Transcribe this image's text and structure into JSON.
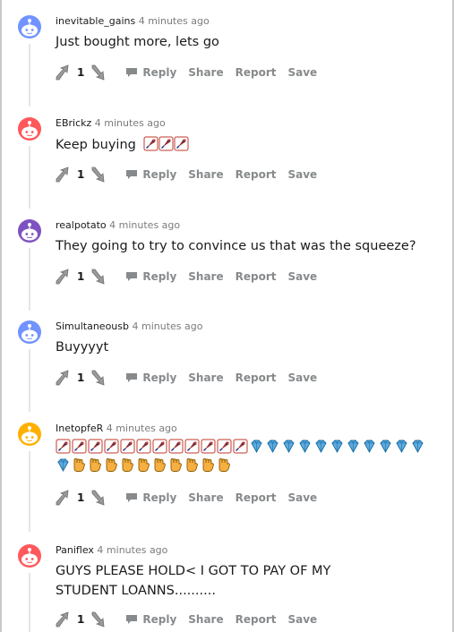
{
  "actions": {
    "reply": "Reply",
    "share": "Share",
    "report": "Report",
    "save": "Save"
  },
  "comments": [
    {
      "user": "inevitable_gains",
      "time": "4 minutes ago",
      "text": "Just bought more, lets go",
      "score": "1",
      "avatar_color": "#7193ff"
    },
    {
      "user": "EBrickz",
      "time": "4 minutes ago",
      "text": "Keep buying",
      "score": "1",
      "avatar_color": "#ff585b",
      "emojis": [
        "rocket-icon",
        "rocket-icon",
        "rocket-icon"
      ]
    },
    {
      "user": "realpotato",
      "time": "4 minutes ago",
      "text": "They going to try to convince us that was the squeeze?",
      "score": "1",
      "avatar_color": "#7e53c1"
    },
    {
      "user": "Simultaneousb",
      "time": "4 minutes ago",
      "text": "Buyyyyt",
      "score": "1",
      "avatar_color": "#7193ff"
    },
    {
      "user": "InetopfeR",
      "time": "4 minutes ago",
      "text": "",
      "score": "1",
      "avatar_color": "#ffb000",
      "emojis": [
        "rocket-icon",
        "rocket-icon",
        "rocket-icon",
        "rocket-icon",
        "rocket-icon",
        "rocket-icon",
        "rocket-icon",
        "rocket-icon",
        "rocket-icon",
        "rocket-icon",
        "rocket-icon",
        "rocket-icon",
        "gem-icon",
        "gem-icon",
        "gem-icon",
        "gem-icon",
        "gem-icon",
        "gem-icon",
        "gem-icon",
        "gem-icon",
        "gem-icon",
        "gem-icon",
        "gem-icon",
        "gem-icon",
        "hand-icon",
        "hand-icon",
        "hand-icon",
        "hand-icon",
        "hand-icon",
        "hand-icon",
        "hand-icon",
        "hand-icon",
        "hand-icon",
        "hand-icon"
      ]
    },
    {
      "user": "Paniflex",
      "time": "4 minutes ago",
      "text": "GUYS PLEASE HOLD< I GOT TO PAY OF MY STUDENT LOANNS..........",
      "score": "1",
      "avatar_color": "#ff585b"
    }
  ]
}
